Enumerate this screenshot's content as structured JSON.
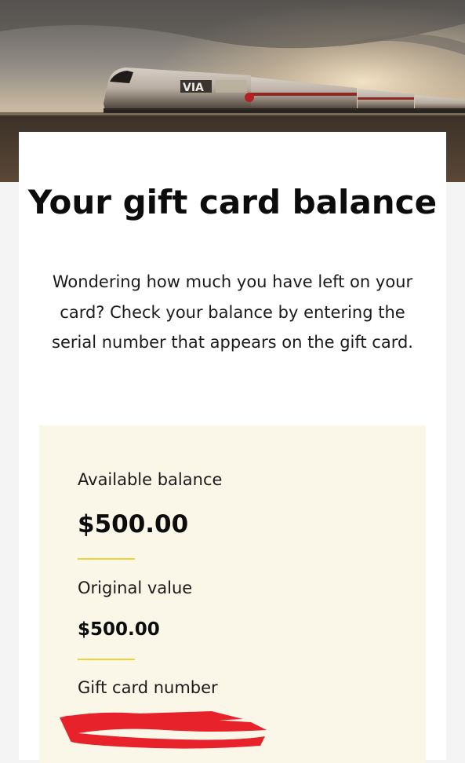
{
  "hero": {
    "train_logo_text": "VIA"
  },
  "page": {
    "title": "Your gift card balance",
    "intro": "Wondering how much you have left on your card? Check your balance by entering the serial number that appears on the gift card."
  },
  "balance": {
    "available_label": "Available balance",
    "available_value": "$500.00",
    "original_label": "Original value",
    "original_value": "$500.00",
    "card_number_label": "Gift card number"
  },
  "colors": {
    "panel_background": "#fbf7e8",
    "accent_divider": "#f0d23a",
    "redaction": "#e8222a"
  }
}
